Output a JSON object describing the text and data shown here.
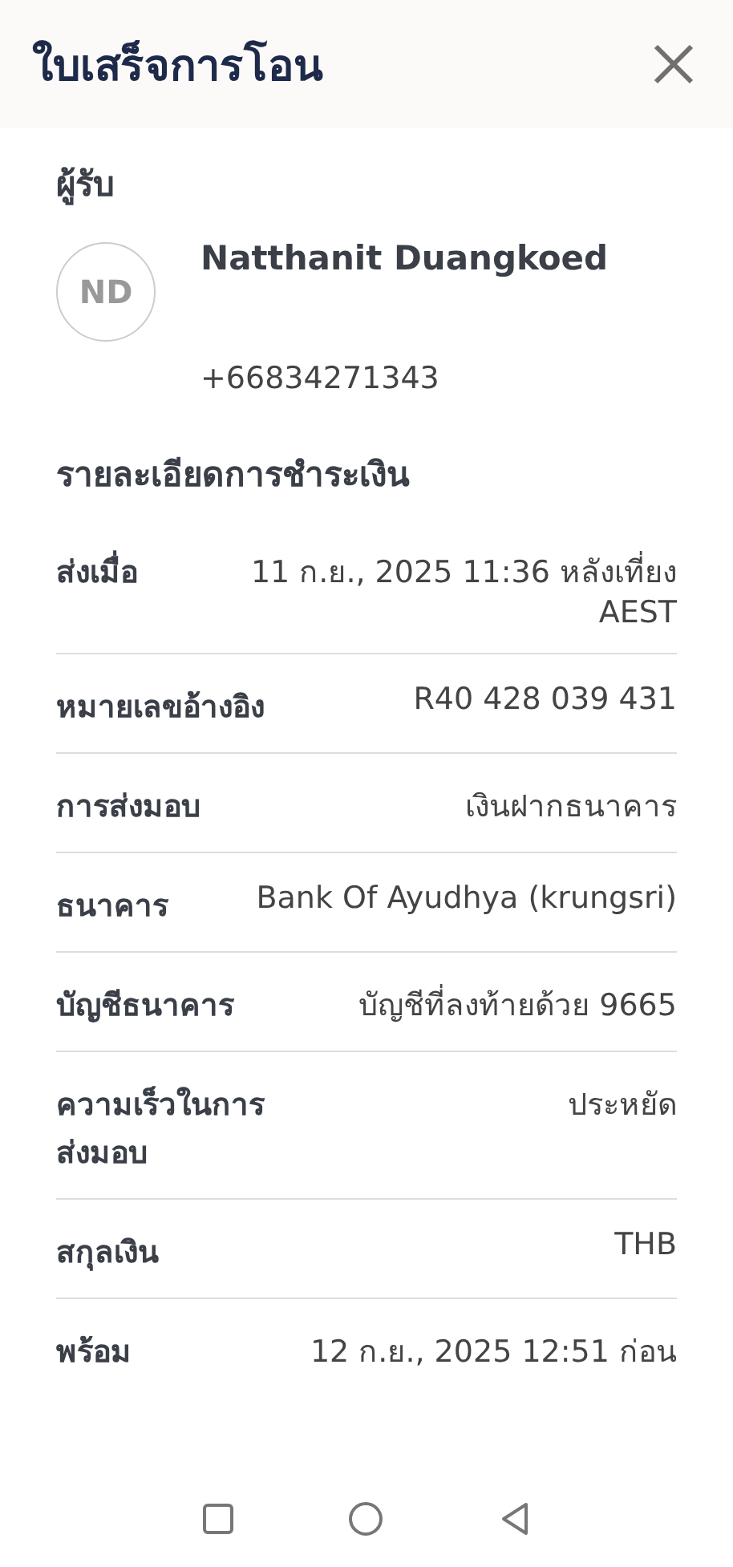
{
  "header": {
    "title": "ใบเสร็จการโอน"
  },
  "recipient": {
    "heading": "ผู้รับ",
    "initials": "ND",
    "name": "Natthanit Duangkoed",
    "phone": "+66834271343"
  },
  "payment": {
    "heading": "รายละเอียดการชำระเงิน",
    "rows": [
      {
        "label": "ส่งเมื่อ",
        "value": "11 ก.ย., 2025 11:36 หลังเที่ยง AEST"
      },
      {
        "label": "หมายเลขอ้างอิง",
        "value": "R40 428 039 431"
      },
      {
        "label": "การส่งมอบ",
        "value": "เงินฝากธนาคาร"
      },
      {
        "label": "ธนาคาร",
        "value": "Bank Of Ayudhya (krungsri)"
      },
      {
        "label": "บัญชีธนาคาร",
        "value": "บัญชีที่ลงท้ายด้วย 9665"
      },
      {
        "label": "ความเร็วในการส่งมอบ",
        "value": "ประหยัด"
      },
      {
        "label": "สกุลเงิน",
        "value": "THB"
      },
      {
        "label": "พร้อม",
        "value": "12 ก.ย., 2025 12:51 ก่อน"
      }
    ]
  }
}
